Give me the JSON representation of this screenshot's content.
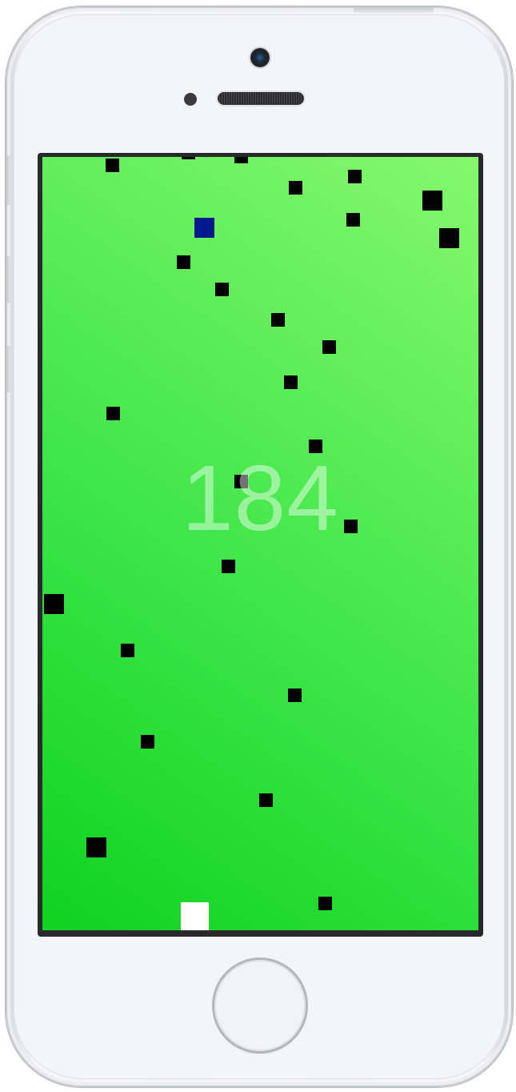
{
  "game": {
    "score": "184",
    "background_gradient": [
      "#0fd21f",
      "#86f86c"
    ],
    "obstacle_color": "#000000",
    "collectible_color": "#001a8c",
    "player_color": "#ffffff"
  },
  "device": {
    "model": "iPhone",
    "color": "silver"
  }
}
